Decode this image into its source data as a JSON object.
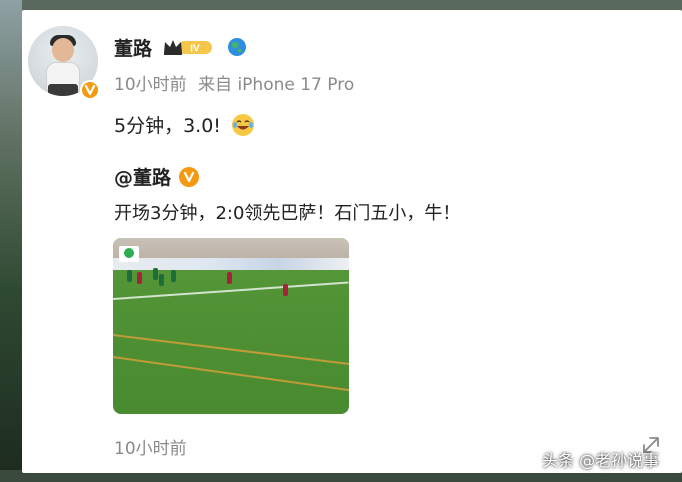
{
  "post": {
    "username": "董路",
    "level_badge": "IV",
    "time_ago": "10小时前",
    "source": "来自 iPhone 17 Pro",
    "text": "5分钟，3.0!",
    "laugh_emoji": "laugh-cry-icon",
    "footer_time": "10小时前"
  },
  "quoted": {
    "user": "@董路",
    "text": "开场3分钟，2:0领先巴萨！石门五小，牛！"
  },
  "watermark": "头条 @老孙说事",
  "colors": {
    "accent_orange": "#f39a12",
    "text_primary": "#222222",
    "text_secondary": "#8a8a8a",
    "globe_blue": "#2f8ee0",
    "globe_green": "#45b36b"
  }
}
